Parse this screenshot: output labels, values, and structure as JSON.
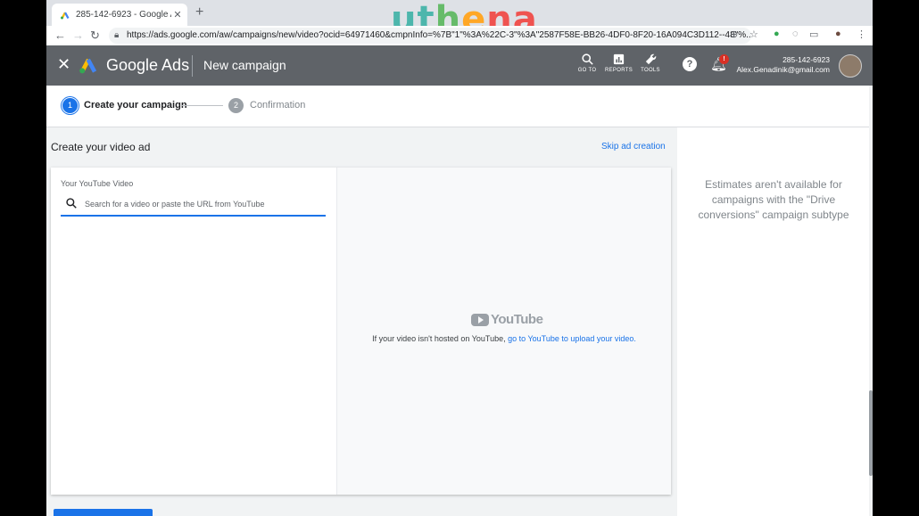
{
  "browser": {
    "tab_title": "285-142-6923 - Google Ads",
    "url": "https://ads.google.com/aw/campaigns/new/video?ocid=64971460&cmpnInfo=%7B\"1\"%3A%22C-3\"%3A\"2587F58E-BB26-4DF0-8F20-16A094C3D112--48\"%...",
    "watermark": [
      "u",
      "t",
      "h",
      "e",
      "n",
      "a"
    ]
  },
  "header": {
    "brand": "Google Ads",
    "page_title": "New campaign",
    "tools": [
      {
        "label": "GO TO"
      },
      {
        "label": "REPORTS"
      },
      {
        "label": "TOOLS"
      }
    ],
    "notification_badge": "!",
    "account_id": "285-142-6923",
    "account_email": "Alex.Genadinik@gmail.com"
  },
  "stepper": {
    "steps": [
      {
        "num": "1",
        "label": "Create your campaign",
        "active": true
      },
      {
        "num": "2",
        "label": "Confirmation",
        "active": false
      }
    ]
  },
  "content": {
    "section_title": "Create your video ad",
    "skip_label": "Skip ad creation",
    "youtube_label": "Your YouTube Video",
    "search_placeholder": "Search for a video or paste the URL from YouTube",
    "yt_wordmark": "YouTube",
    "yt_msg_prefix": "If your video isn't hosted on YouTube, ",
    "yt_msg_link": "go to YouTube to upload your video."
  },
  "sidebar": {
    "estimates_text": "Estimates aren't available for campaigns with the \"Drive conversions\" campaign subtype"
  },
  "colors": {
    "accent": "#1a73e8",
    "header_bg": "#5f6368",
    "alert": "#d93025"
  }
}
